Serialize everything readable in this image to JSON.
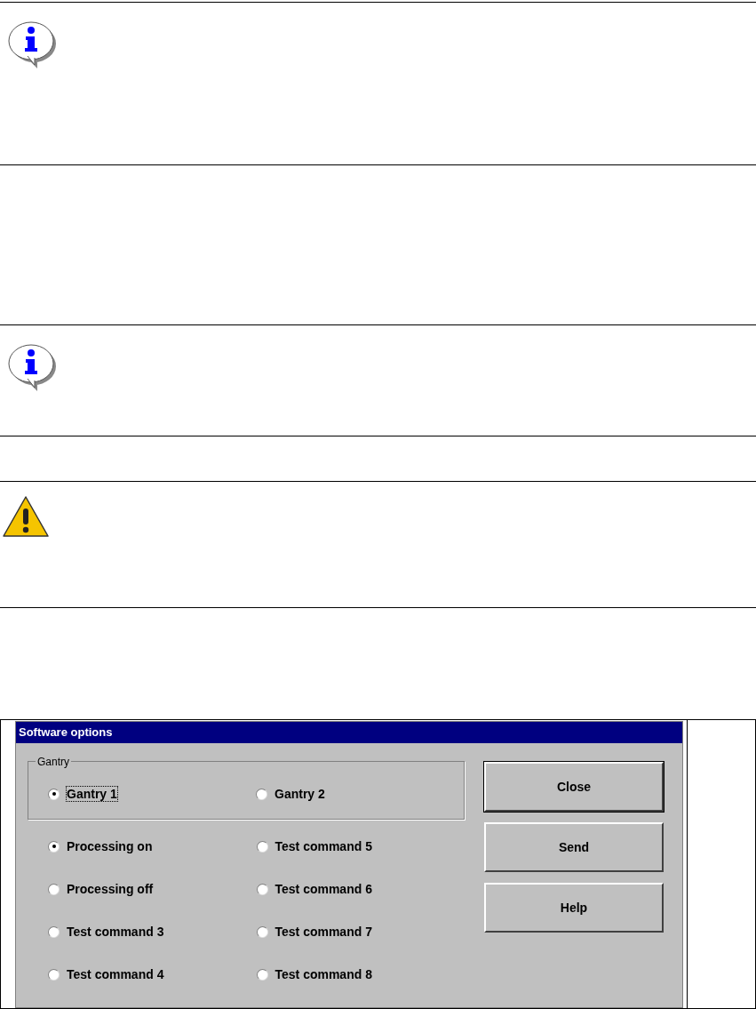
{
  "notes": [
    {
      "kind": "info"
    },
    {
      "kind": "blank"
    },
    {
      "kind": "info"
    },
    {
      "kind": "blank"
    },
    {
      "kind": "warning"
    }
  ],
  "dialog": {
    "title": "Software options",
    "group": {
      "label": "Gantry",
      "options": [
        {
          "label": "Gantry 1",
          "selected": true,
          "focused": true
        },
        {
          "label": "Gantry 2",
          "selected": false,
          "focused": false
        }
      ]
    },
    "commands": [
      {
        "label": "Processing on",
        "selected": true
      },
      {
        "label": "Processing off",
        "selected": false
      },
      {
        "label": "Test command 3",
        "selected": false
      },
      {
        "label": "Test command 4",
        "selected": false
      },
      {
        "label": "Test command 5",
        "selected": false
      },
      {
        "label": "Test command 6",
        "selected": false
      },
      {
        "label": "Test command 7",
        "selected": false
      },
      {
        "label": "Test command 8",
        "selected": false
      }
    ],
    "buttons": [
      {
        "label": "Close",
        "default": true
      },
      {
        "label": "Send",
        "default": false
      },
      {
        "label": "Help",
        "default": false
      }
    ]
  }
}
